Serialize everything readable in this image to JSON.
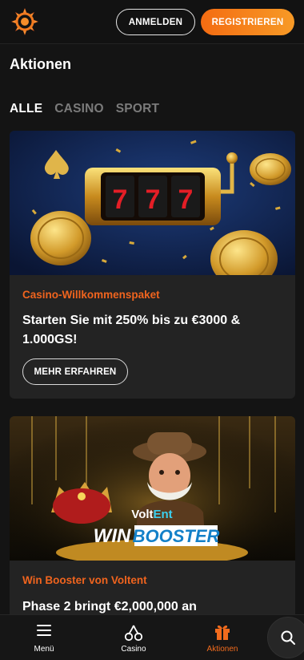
{
  "header": {
    "login_label": "ANMELDEN",
    "register_label": "REGISTRIEREN",
    "logo_icon": "sun-logo-icon",
    "accent": "#f46c12"
  },
  "page": {
    "title": "Aktionen"
  },
  "filters": [
    {
      "label": "ALLE",
      "active": true
    },
    {
      "label": "CASINO",
      "active": false
    },
    {
      "label": "SPORT",
      "active": false
    }
  ],
  "promotions": [
    {
      "category": "Casino-Willkommenspaket",
      "title": "Starten Sie mit 250% bis zu €3000 & 1.000GS!",
      "button_label": "MEHR ERFAHREN",
      "banner": {
        "reel_symbols": [
          "7",
          "7",
          "7"
        ]
      }
    },
    {
      "category": "Win Booster von Voltent",
      "title": "Phase 2 bringt €2,000,000 an",
      "banner": {
        "brand_volt": "Volt",
        "brand_ent": "Ent",
        "word_win": "WIN",
        "word_booster": "BOOSTER"
      }
    }
  ],
  "bottom_nav": {
    "menu": "Menü",
    "casino": "Casino",
    "actions": "Aktionen",
    "active_color": "#f26b1d"
  }
}
